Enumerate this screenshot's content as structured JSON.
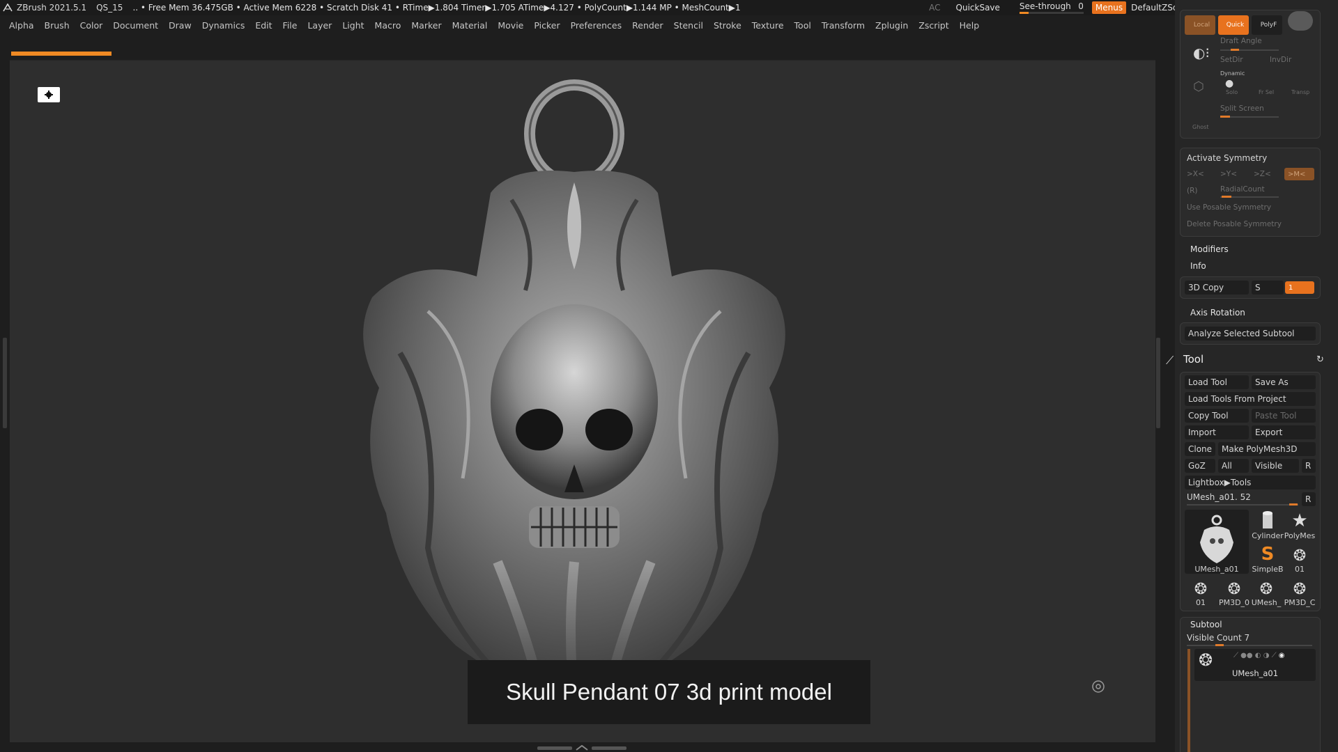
{
  "title_bar": {
    "app": "ZBrush 2021.5.1",
    "doc": "QS_15",
    "stats": ".. • Free Mem 36.475GB • Active Mem 6228 • Scratch Disk 41 •  RTime▶1.804 Timer▶1.705 ATime▶4.127 • PolyCount▶1.144 MP  • MeshCount▶1",
    "ac": "AC",
    "quicksave": "QuickSave",
    "see_through_label": "See-through",
    "see_through_value": "0",
    "see_through_level": 0.14,
    "menus": "Menus",
    "script": "DefaultZScript"
  },
  "menu": [
    "Alpha",
    "Brush",
    "Color",
    "Document",
    "Draw",
    "Dynamics",
    "Edit",
    "File",
    "Layer",
    "Light",
    "Macro",
    "Marker",
    "Material",
    "Movie",
    "Picker",
    "Preferences",
    "Render",
    "Stencil",
    "Stroke",
    "Texture",
    "Tool",
    "Transform",
    "Zplugin",
    "Zscript",
    "Help"
  ],
  "viewport": {
    "caption": "Skull Pendant 07 3d print model",
    "progress_level": 1.0
  },
  "right_panel": {
    "top": {
      "local": "Local",
      "quick": "Quick",
      "polyf": "PolyF",
      "draft_angle": "Draft Angle",
      "setdir": "SetDir",
      "invdir": "InvDir",
      "dynamic": "Dynamic",
      "solo": "Solo",
      "frsel": "Fr Sel",
      "transp": "Transp",
      "split_screen": "Split Screen",
      "ghost": "Ghost"
    },
    "symmetry": {
      "title": "Activate Symmetry",
      "x": ">X<",
      "y": ">Y<",
      "z": ">Z<",
      "m": ">M<",
      "r": "(R)",
      "radial": "RadialCount",
      "posable": "Use Posable Symmetry",
      "delete_posable": "Delete Posable Symmetry"
    },
    "modifiers": "Modifiers",
    "info": "Info",
    "copy3d": "3D Copy",
    "copy_s": "S",
    "copy_val": "1",
    "axis_rotation": "Axis Rotation",
    "analyze": "Analyze Selected Subtool",
    "tool": {
      "title": "Tool",
      "load_tool": "Load Tool",
      "save_as": "Save As",
      "load_from_project": "Load Tools From Project",
      "copy_tool": "Copy Tool",
      "paste_tool": "Paste Tool",
      "import": "Import",
      "export": "Export",
      "clone": "Clone",
      "make_polymesh": "Make PolyMesh3D",
      "goz": "GoZ",
      "all": "All",
      "visible": "Visible",
      "r": "R",
      "lightbox": "Lightbox▶Tools",
      "current": "UMesh_a01. 52",
      "current_r": "R",
      "thumbs": {
        "main": "UMesh_a01",
        "cylinder": "Cylinder",
        "polymesh": "PolyMes",
        "simpleb": "SimpleB",
        "t01a": "01",
        "t01b": "01",
        "pm3d_a": "PM3D_0",
        "umesh": "UMesh_",
        "pm3d_b": "PM3D_C"
      }
    },
    "subtool": {
      "title": "Subtool",
      "visible_count": "Visible Count 7",
      "item_name": "UMesh_a01"
    }
  }
}
